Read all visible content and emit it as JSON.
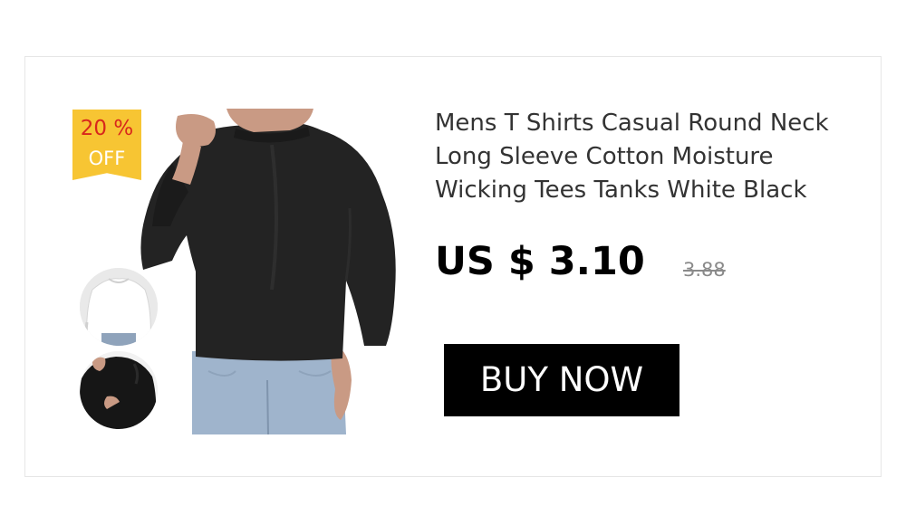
{
  "product": {
    "title": "Mens T Shirts Casual Round Neck Long Sleeve Cotton Moisture Wicking Tees Tanks White Black",
    "price": "US $ 3.10",
    "old_price": "3.88"
  },
  "badge": {
    "discount": "20 %",
    "off_label": "OFF"
  },
  "actions": {
    "buy_label": "BUY NOW"
  },
  "thumbnails": [
    {
      "variant": "white"
    },
    {
      "variant": "black"
    }
  ],
  "colors": {
    "badge_bg": "#f7c533",
    "badge_text": "#d8271c",
    "button_bg": "#000000",
    "button_text": "#ffffff",
    "old_price": "#8a8a8a",
    "card_border": "#e6e6e6"
  }
}
